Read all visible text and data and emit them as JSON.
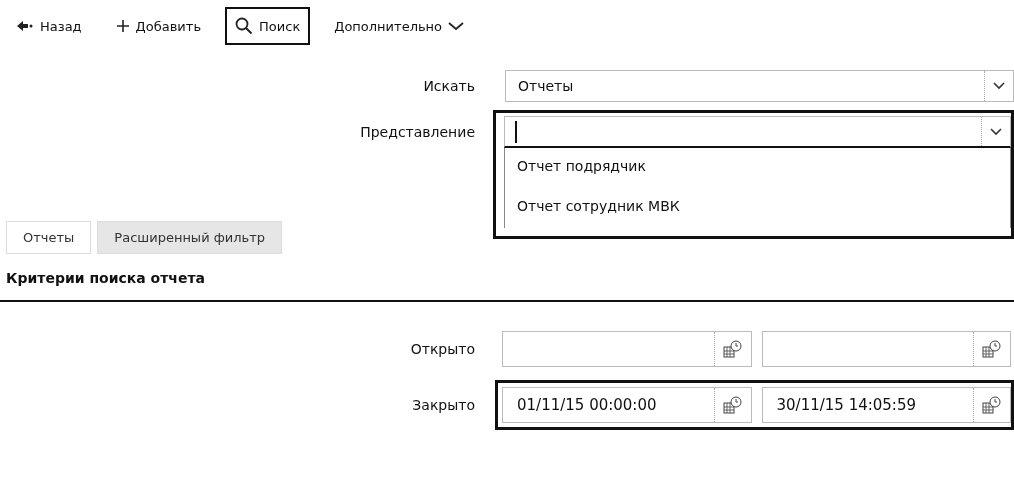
{
  "toolbar": [
    {
      "kind": "back",
      "label": "Назад",
      "highlighted": false
    },
    {
      "kind": "add",
      "label": "Добавить",
      "highlighted": false
    },
    {
      "kind": "search",
      "label": "Поиск",
      "highlighted": true
    },
    {
      "kind": "more",
      "label": "Дополнительно",
      "highlighted": false
    }
  ],
  "search_in": {
    "label": "Искать",
    "value": "Отчеты"
  },
  "view": {
    "label": "Представление",
    "highlighted": true,
    "expanded": true,
    "options": [
      "Отчет подрядчик",
      "Отчет сотрудник МВК"
    ]
  },
  "tabs": [
    {
      "label": "Отчеты",
      "selected": true
    },
    {
      "label": "Расширенный фильтр",
      "selected": false
    }
  ],
  "section_title": "Критерии поиска отчета",
  "date_rows": [
    {
      "label": "Открыто",
      "from": "",
      "to": "",
      "highlighted": false
    },
    {
      "label": "Закрыто",
      "from": "01/11/15 00:00:00",
      "to": "30/11/15 14:05:59",
      "highlighted": true
    }
  ]
}
